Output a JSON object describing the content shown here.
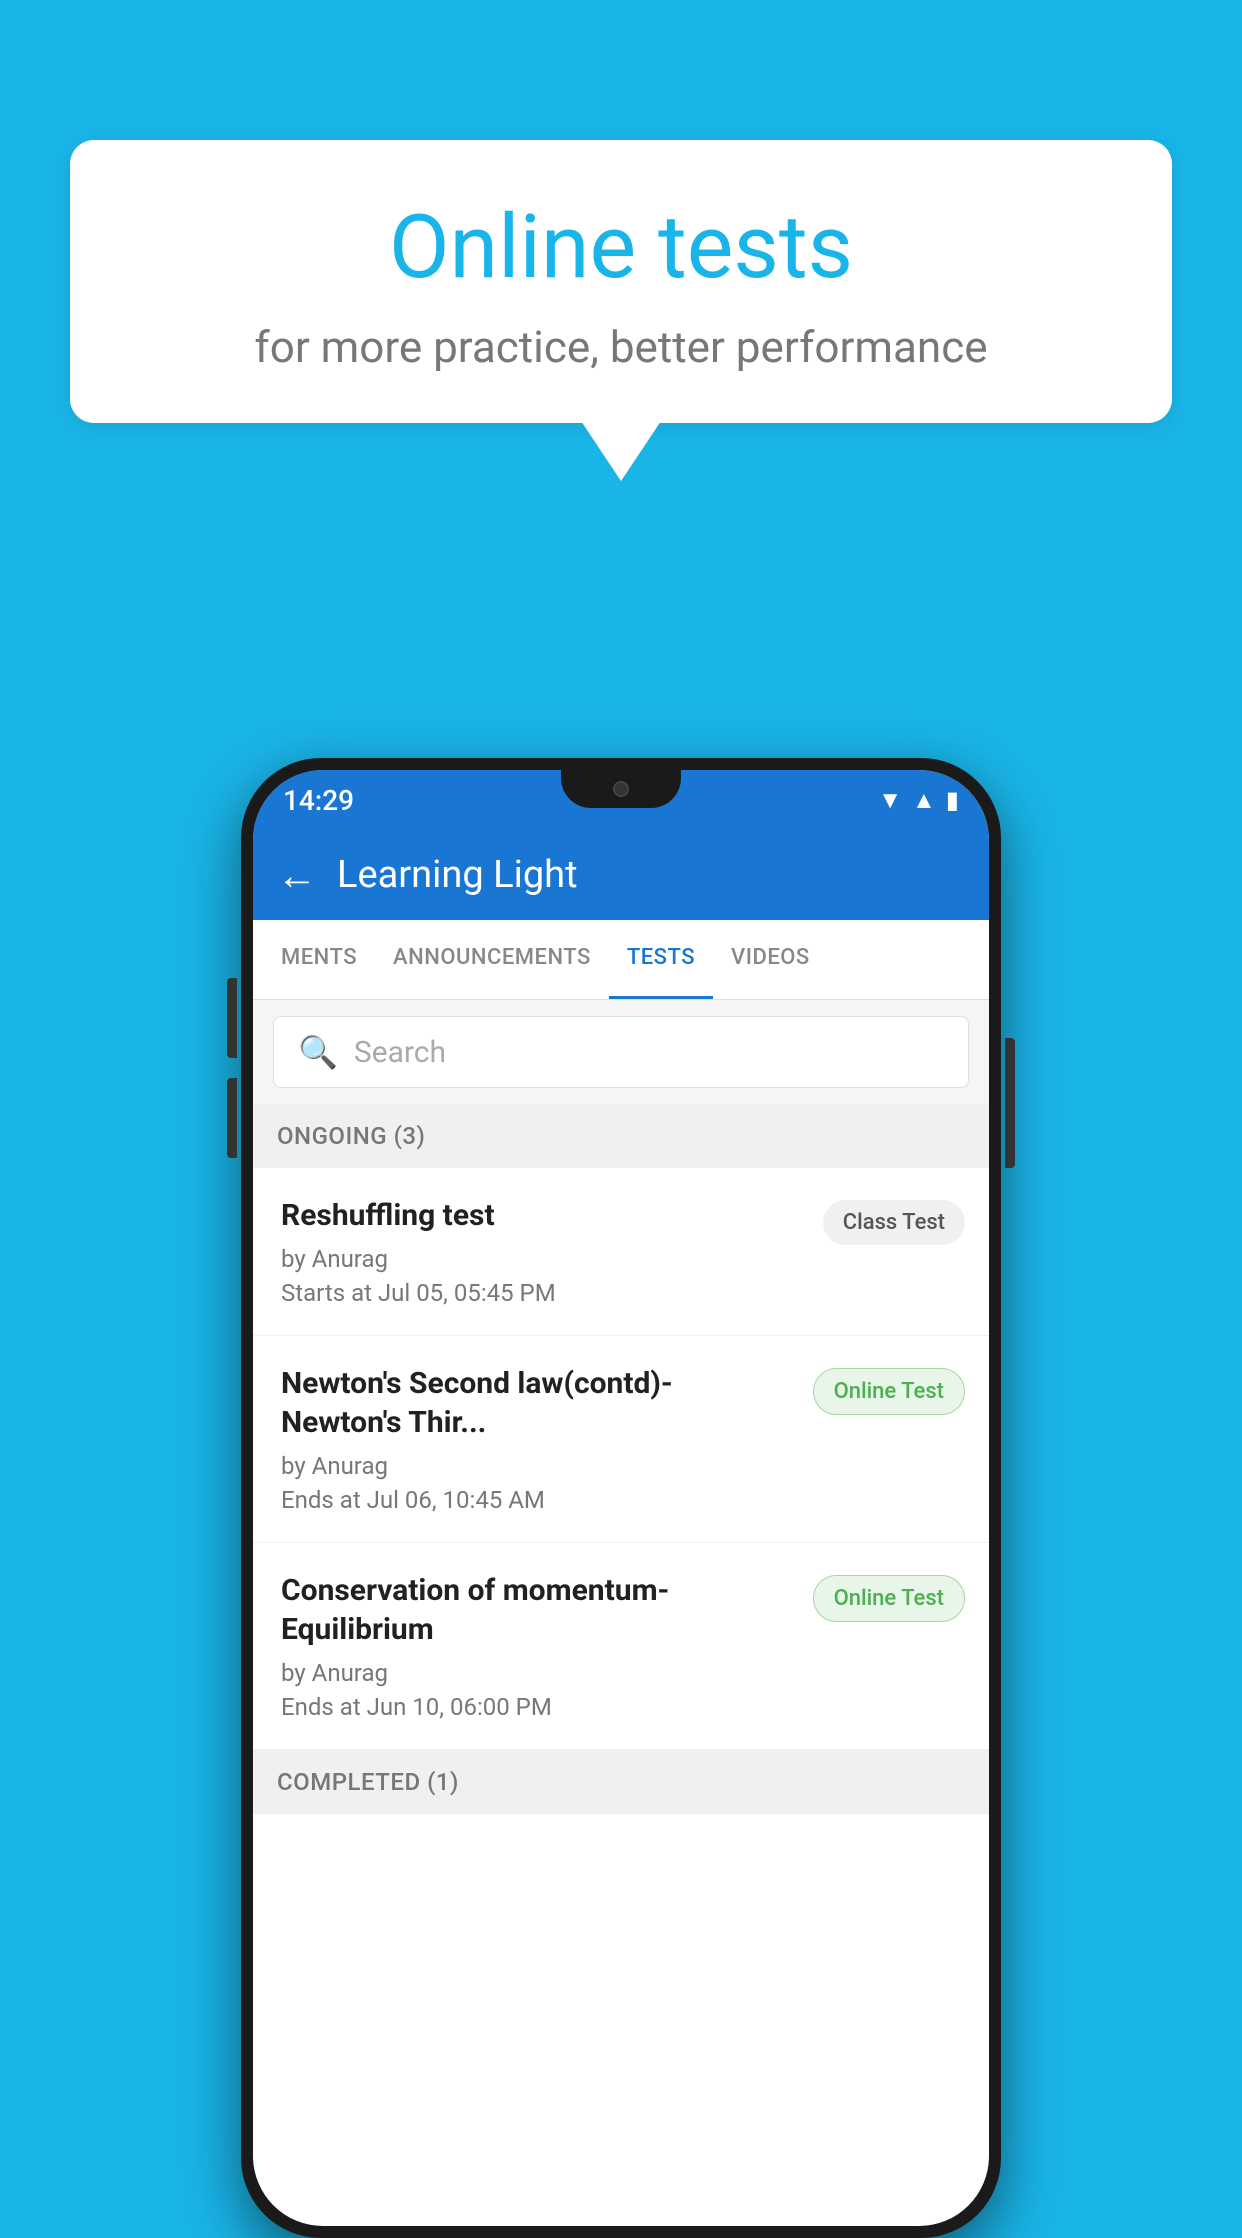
{
  "background_color": "#1ab5e8",
  "bubble": {
    "title": "Online tests",
    "subtitle": "for more practice, better performance"
  },
  "status_bar": {
    "time": "14:29",
    "icons": [
      "wifi",
      "signal",
      "battery"
    ]
  },
  "app_bar": {
    "title": "Learning Light",
    "back_label": "←"
  },
  "tabs": [
    {
      "label": "MENTS",
      "active": false
    },
    {
      "label": "ANNOUNCEMENTS",
      "active": false
    },
    {
      "label": "TESTS",
      "active": true
    },
    {
      "label": "VIDEOS",
      "active": false
    }
  ],
  "search": {
    "placeholder": "Search"
  },
  "sections": [
    {
      "header": "ONGOING (3)",
      "items": [
        {
          "name": "Reshuffling test",
          "author": "by Anurag",
          "date": "Starts at  Jul 05, 05:45 PM",
          "badge": "Class Test",
          "badge_type": "class"
        },
        {
          "name": "Newton's Second law(contd)-Newton's Thir...",
          "author": "by Anurag",
          "date": "Ends at  Jul 06, 10:45 AM",
          "badge": "Online Test",
          "badge_type": "online"
        },
        {
          "name": "Conservation of momentum-Equilibrium",
          "author": "by Anurag",
          "date": "Ends at  Jun 10, 06:00 PM",
          "badge": "Online Test",
          "badge_type": "online"
        }
      ]
    }
  ],
  "completed_header": "COMPLETED (1)"
}
